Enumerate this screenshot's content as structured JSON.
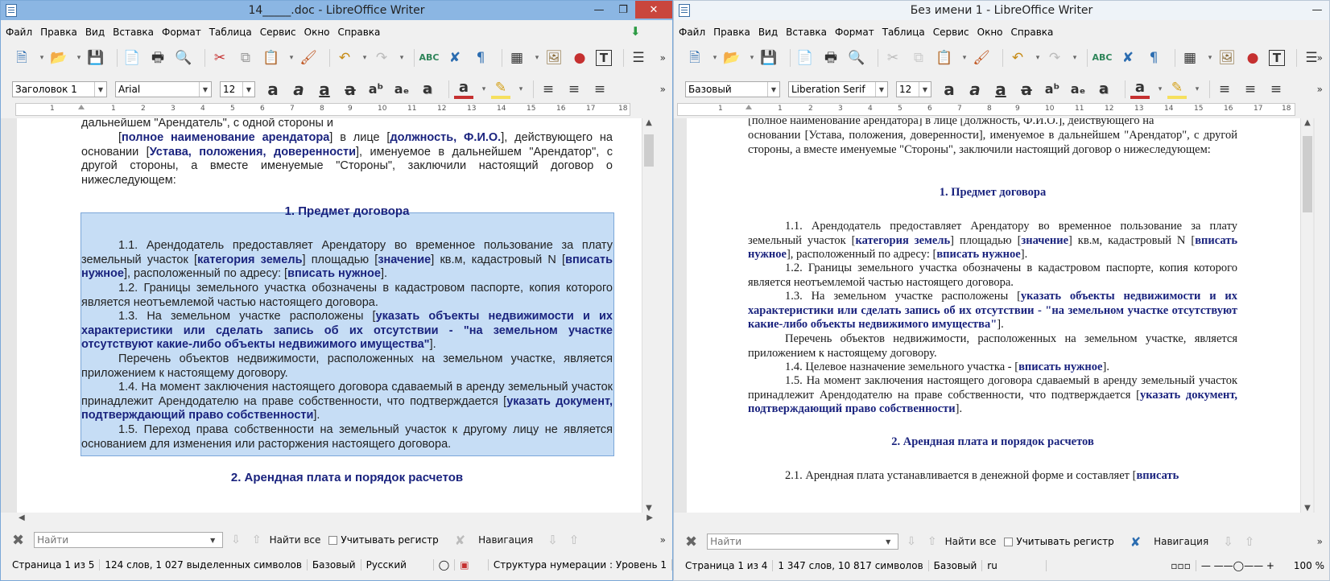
{
  "left_window": {
    "title": "14_____.doc - LibreOffice Writer",
    "menu": [
      "Файл",
      "Правка",
      "Вид",
      "Вставка",
      "Формат",
      "Таблица",
      "Сервис",
      "Окно",
      "Справка"
    ],
    "style_value": "Заголовок 1",
    "font_value": "Arial",
    "size_value": "12",
    "ruler_numbers": [
      "1",
      "1",
      "2",
      "3",
      "4",
      "5",
      "6",
      "7",
      "8",
      "9",
      "10",
      "11",
      "12",
      "13",
      "14",
      "15",
      "16",
      "17",
      "18"
    ],
    "doc": {
      "para0_line1": "дальнейшем \"Арендатель\", с одной стороны и",
      "para0": [
        {
          "t": "[",
          "b": false
        },
        {
          "t": "полное наименование арендатора",
          "b": true
        },
        {
          "t": "] в лице [",
          "b": false
        },
        {
          "t": "должность, Ф.И.О.",
          "b": true
        },
        {
          "t": "], действующего на основании [",
          "b": false
        },
        {
          "t": "Устава, положения, доверенности",
          "b": true
        },
        {
          "t": "], именуемое в дальнейшем \"Арендатор\", с другой стороны, а вместе именуемые \"Стороны\", заключили настоящий договор о нижеследующем:",
          "b": false
        }
      ],
      "heading1": "1. Предмет договора",
      "p11": [
        {
          "t": "1.1. Арендодатель предоставляет Арендатору во временное пользование за плату земельный участок [",
          "b": false
        },
        {
          "t": "категория земель",
          "b": true
        },
        {
          "t": "] площадью [",
          "b": false
        },
        {
          "t": "значение",
          "b": true
        },
        {
          "t": "] кв.м, кадастровый N [",
          "b": false
        },
        {
          "t": "вписать нужное",
          "b": true
        },
        {
          "t": "], расположенный по адресу: [",
          "b": false
        },
        {
          "t": "вписать нужное",
          "b": true
        },
        {
          "t": "].",
          "b": false
        }
      ],
      "p12": "1.2. Границы земельного участка обозначены в кадастровом паспорте, копия которого является неотъемлемой частью настоящего договора.",
      "p13": [
        {
          "t": "1.3. На земельном участке расположены [",
          "b": false
        },
        {
          "t": "указать объекты недвижимости и их характеристики или сделать запись об их отсутствии - \"на земельном участке отсутствуют какие-либо объекты недвижимого имущества\"",
          "b": true
        },
        {
          "t": "].",
          "b": false
        }
      ],
      "p13b": "Перечень объектов недвижимости, расположенных на земельном участке, является приложением к настоящему договору.",
      "p14": [
        {
          "t": "1.4. На момент заключения настоящего договора сдаваемый в аренду земельный участок принадлежит Арендодателю на праве собственности, что подтверждается [",
          "b": false
        },
        {
          "t": "указать документ, подтверждающий право собственности",
          "b": true
        },
        {
          "t": "].",
          "b": false
        }
      ],
      "p15": "1.5. Переход права собственности на земельный участок к другому лицу не является основанием для изменения или расторжения настоящего договора.",
      "heading2": "2. Арендная плата и порядок расчетов"
    },
    "find": {
      "placeholder": "Найти",
      "find_all": "Найти все",
      "match_case": "Учитывать регистр",
      "navigation": "Навигация"
    },
    "status": {
      "page": "Страница 1 из 5",
      "words": "124 слов, 1 027 выделенных символов",
      "style": "Базовый",
      "lang": "Русский",
      "outline": "Структура нумерации : Уровень 1"
    }
  },
  "right_window": {
    "title": "Без имени 1 - LibreOffice Writer",
    "menu": [
      "Файл",
      "Правка",
      "Вид",
      "Вставка",
      "Формат",
      "Таблица",
      "Сервис",
      "Окно",
      "Справка"
    ],
    "style_value": "Базовый",
    "font_value": "Liberation Serif",
    "size_value": "12",
    "ruler_numbers": [
      "1",
      "1",
      "2",
      "3",
      "4",
      "5",
      "6",
      "7",
      "8",
      "9",
      "10",
      "11",
      "12",
      "13",
      "14",
      "15",
      "16",
      "17",
      "18"
    ],
    "doc": {
      "top_line": "[полное наименование арендатора] в лице [должность, Ф.И.О.], действующего на",
      "para0": "основании [Устава, положения, доверенности], именуемое в дальнейшем \"Арендатор\", с другой стороны, а вместе именуемые \"Стороны\", заключили настоящий договор о нижеследующем:",
      "heading1": "1. Предмет договора",
      "p11": [
        {
          "t": "1.1. Арендодатель предоставляет Арендатору во временное пользование за плату земельный участок [",
          "b": false
        },
        {
          "t": "категория земель",
          "b": true
        },
        {
          "t": "] площадью [",
          "b": false
        },
        {
          "t": "значение",
          "b": true
        },
        {
          "t": "] кв.м, кадастровый N [",
          "b": false
        },
        {
          "t": "вписать нужное",
          "b": true
        },
        {
          "t": "], расположенный по адресу: [",
          "b": false
        },
        {
          "t": "вписать нужное",
          "b": true
        },
        {
          "t": "].",
          "b": false
        }
      ],
      "p12": "1.2. Границы земельного участка обозначены в кадастровом паспорте, копия которого является неотъемлемой частью настоящего договора.",
      "p13": [
        {
          "t": "1.3. На земельном участке расположены [",
          "b": false
        },
        {
          "t": "указать объекты недвижимости и их характеристики или сделать запись об их отсутствии - \"на земельном участке отсутствуют какие-либо объекты недвижимого имущества\"",
          "b": true
        },
        {
          "t": "].",
          "b": false
        }
      ],
      "p13b": "Перечень объектов недвижимости, расположенных на земельном участке, является приложением к настоящему договору.",
      "p14": [
        {
          "t": "1.4. Целевое назначение земельного участка - [",
          "b": false
        },
        {
          "t": "вписать нужное",
          "b": true
        },
        {
          "t": "].",
          "b": false
        }
      ],
      "p15": [
        {
          "t": "1.5. На момент заключения настоящего договора сдаваемый в аренду земельный участок принадлежит Арендодателю на праве собственности, что подтверждается [",
          "b": false
        },
        {
          "t": "указать документ, подтверждающий право собственности",
          "b": true
        },
        {
          "t": "].",
          "b": false
        }
      ],
      "heading2": "2. Арендная плата и порядок расчетов",
      "p21": [
        {
          "t": "2.1. Арендная плата устанавливается в денежной форме и составляет [",
          "b": false
        },
        {
          "t": "вписать",
          "b": true
        }
      ]
    },
    "find": {
      "placeholder": "Найти",
      "find_all": "Найти все",
      "match_case": "Учитывать регистр",
      "navigation": "Навигация"
    },
    "status": {
      "page": "Страница 1 из 4",
      "words": "1 347 слов, 10 817 символов",
      "style": "Базовый",
      "lang": "ru",
      "zoom": "100 %"
    }
  },
  "colors": {
    "selection": "#c6ddf5",
    "placeholder_text": "#1a237e",
    "left_titlebar": "#8bb6e3",
    "close_button": "#c9463d"
  }
}
